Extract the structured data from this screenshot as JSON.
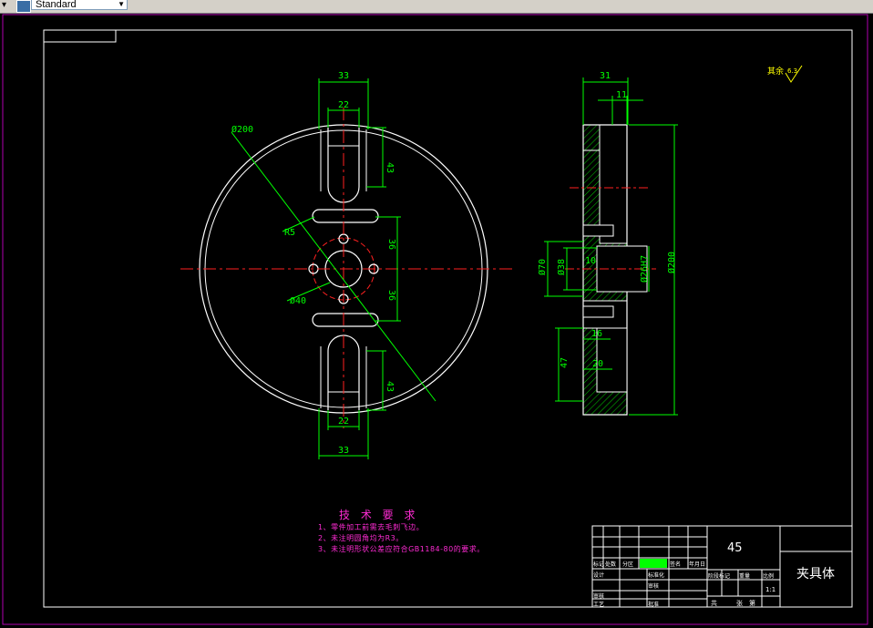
{
  "toolbar": {
    "text_style": "Standard"
  },
  "drawing": {
    "roughness_note": "其余",
    "roughness_value": "6.3",
    "tech_title": "技 术 要 求",
    "tech_requirements": [
      "1、零件加工前需去毛刺飞边。",
      "2、未注明圆角均为R3。",
      "3、未注明形状公差应符合GB1184-80的要求。"
    ],
    "front_view_dims": {
      "top_width": "33",
      "slot_width_top": "22",
      "slot_len_top": "43",
      "dia_outer": "Ø200",
      "radius_slot": "R5",
      "offset_upper": "36",
      "offset_lower": "36",
      "dia_hole_circle": "Ø40",
      "slot_len_bottom": "43",
      "slot_width_bottom": "22",
      "bottom_width": "33"
    },
    "side_view_dims": {
      "total_width": "31",
      "inner_width": "11",
      "dia_70": "Ø70",
      "dia_38": "Ø38",
      "dia_fit": "Ø26H7",
      "dia_200": "Ø200",
      "step_10": "10",
      "step_16": "16",
      "step_20": "20",
      "depth_47": "47"
    },
    "title_block": {
      "material": "45",
      "part_name": "夹具体",
      "labels": {
        "mark": "标记",
        "count": "处数",
        "zone": "分区",
        "change_doc": "更改文件号",
        "sign": "签名",
        "date": "年月日",
        "design": "设计",
        "standardize": "标准化",
        "stage_mark": "阶段标记",
        "weight": "重量",
        "scale": "比例",
        "check": "审核",
        "craft": "工艺",
        "approve": "批准",
        "review": "审核",
        "sheet_total": "共",
        "sheet_unit": "张",
        "sheet_no": "第",
        "scale_value": "1:1"
      }
    }
  }
}
